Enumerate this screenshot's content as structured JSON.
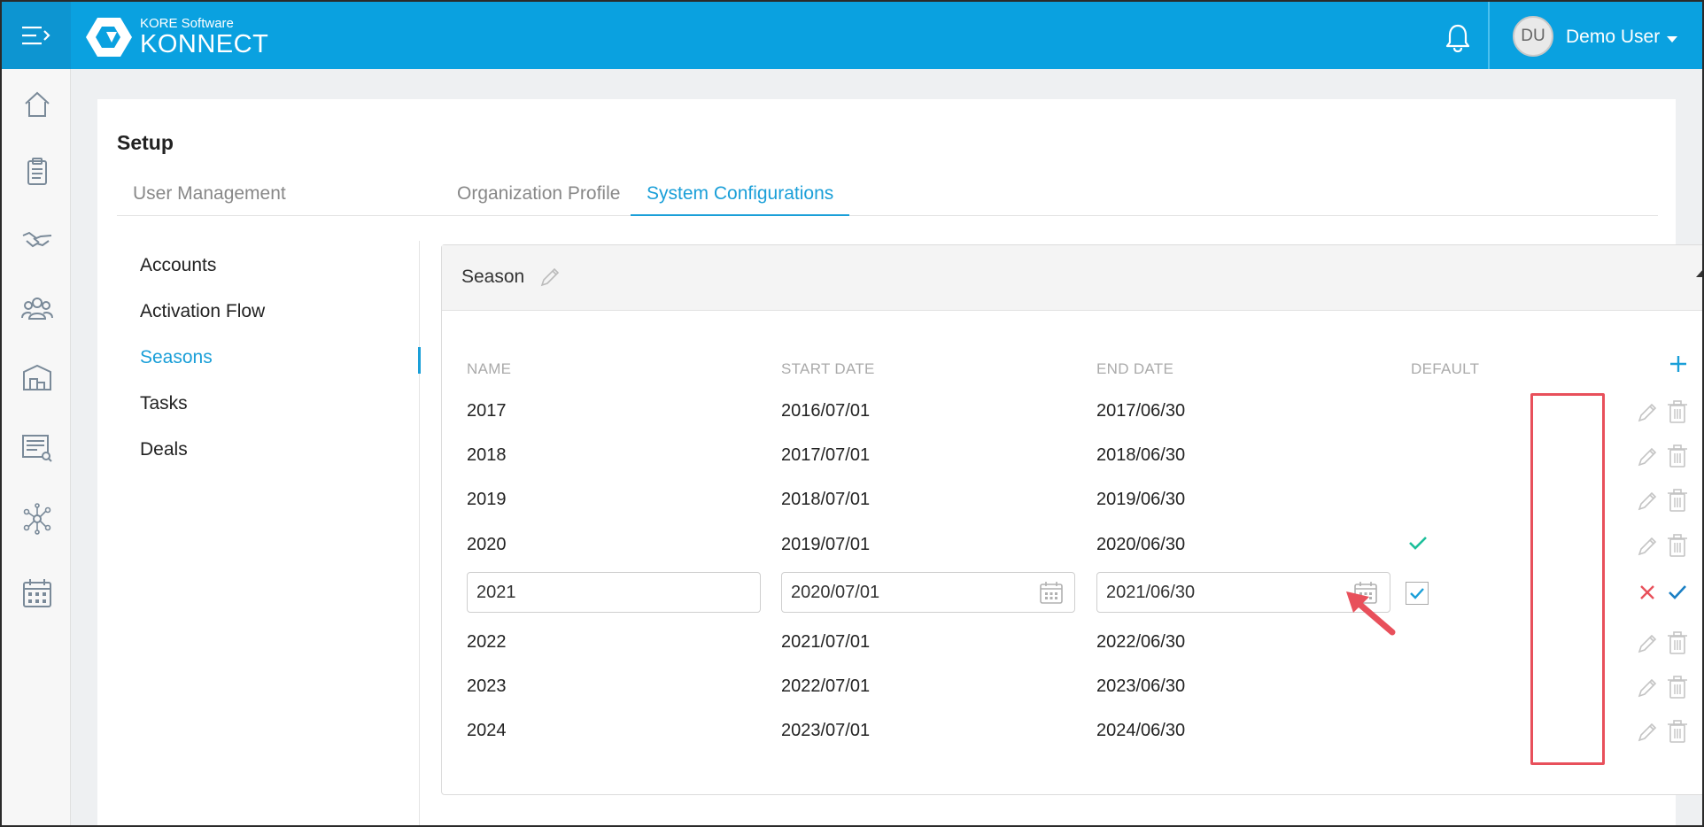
{
  "header": {
    "brand_small": "KORE Software",
    "brand_big": "KONNECT",
    "user_initials": "DU",
    "user_name": "Demo User"
  },
  "icons": {
    "menu": "hamburger-expand-icon",
    "notifications": "bell-icon",
    "rail": [
      "home-icon",
      "clipboard-icon",
      "handshake-icon",
      "group-icon",
      "warehouse-icon",
      "report-search-icon",
      "network-icon",
      "calendar-icon"
    ]
  },
  "page": {
    "title": "Setup",
    "tabs": [
      {
        "label": "User Management",
        "active": false
      },
      {
        "label": "Organization Profile",
        "active": false
      },
      {
        "label": "System Configurations",
        "active": true
      }
    ]
  },
  "side_menu": {
    "items": [
      {
        "label": "Accounts",
        "active": false
      },
      {
        "label": "Activation Flow",
        "active": false
      },
      {
        "label": "Seasons",
        "active": true
      },
      {
        "label": "Tasks",
        "active": false
      },
      {
        "label": "Deals",
        "active": false
      }
    ]
  },
  "panel": {
    "title": "Season",
    "columns": {
      "name": "NAME",
      "start": "START DATE",
      "end": "END DATE",
      "default": "DEFAULT"
    },
    "rows": [
      {
        "name": "2017",
        "start": "2016/07/01",
        "end": "2017/06/30",
        "default": false
      },
      {
        "name": "2018",
        "start": "2017/07/01",
        "end": "2018/06/30",
        "default": false
      },
      {
        "name": "2019",
        "start": "2018/07/01",
        "end": "2019/06/30",
        "default": false
      },
      {
        "name": "2020",
        "start": "2019/07/01",
        "end": "2020/06/30",
        "default": true
      },
      {
        "name": "2021",
        "start": "2020/07/01",
        "end": "2021/06/30",
        "default": true,
        "editing": true
      },
      {
        "name": "2022",
        "start": "2021/07/01",
        "end": "2022/06/30",
        "default": false
      },
      {
        "name": "2023",
        "start": "2022/07/01",
        "end": "2023/06/30",
        "default": false
      },
      {
        "name": "2024",
        "start": "2023/07/01",
        "end": "2024/06/30",
        "default": false
      }
    ]
  },
  "colors": {
    "topbar": "#0aa1e0",
    "accent": "#1a9fd8",
    "success": "#1bbf9a",
    "danger": "#e8505b",
    "muted_icon": "#c4c4c4"
  }
}
